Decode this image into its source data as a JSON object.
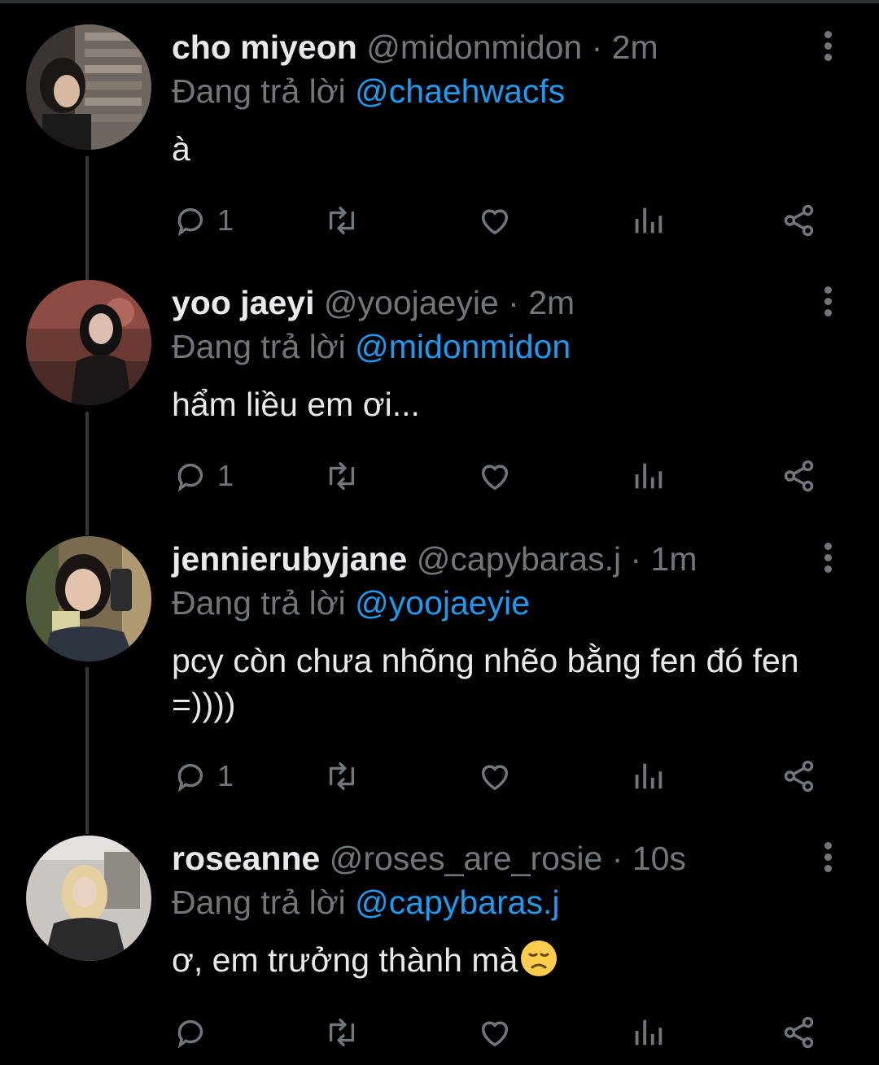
{
  "reply_prefix": "Đang trả lời",
  "tweets": [
    {
      "name": "cho miyeon",
      "handle": "@midonmidon",
      "time": "2m",
      "replying_to": "@chaehwacfs",
      "text": "à",
      "reply_count": "1"
    },
    {
      "name": "yoo jaeyi",
      "handle": "@yoojaeyie",
      "time": "2m",
      "replying_to": "@midonmidon",
      "text": "hẩm liều em ơi...",
      "reply_count": "1"
    },
    {
      "name": "jennierubyjane",
      "handle": "@capybaras.j",
      "time": "1m",
      "replying_to": "@yoojaeyie",
      "text": "pcy còn chưa nhõng nhẽo bằng fen đó fen =))))",
      "reply_count": "1"
    },
    {
      "name": "roseanne",
      "handle": "@roses_are_rosie",
      "time": "10s",
      "replying_to": "@capybaras.j",
      "text": "ơ, em trưởng thành mà",
      "emoji": "disappointed-face",
      "reply_count": ""
    }
  ],
  "colors": {
    "background": "#000000",
    "primary_text": "#e7e9ea",
    "secondary_text": "#71767b",
    "link": "#1d9bf0",
    "thread_line": "#333639"
  },
  "icons": [
    "reply-icon",
    "retweet-icon",
    "like-icon",
    "views-icon",
    "share-icon",
    "more-icon"
  ]
}
